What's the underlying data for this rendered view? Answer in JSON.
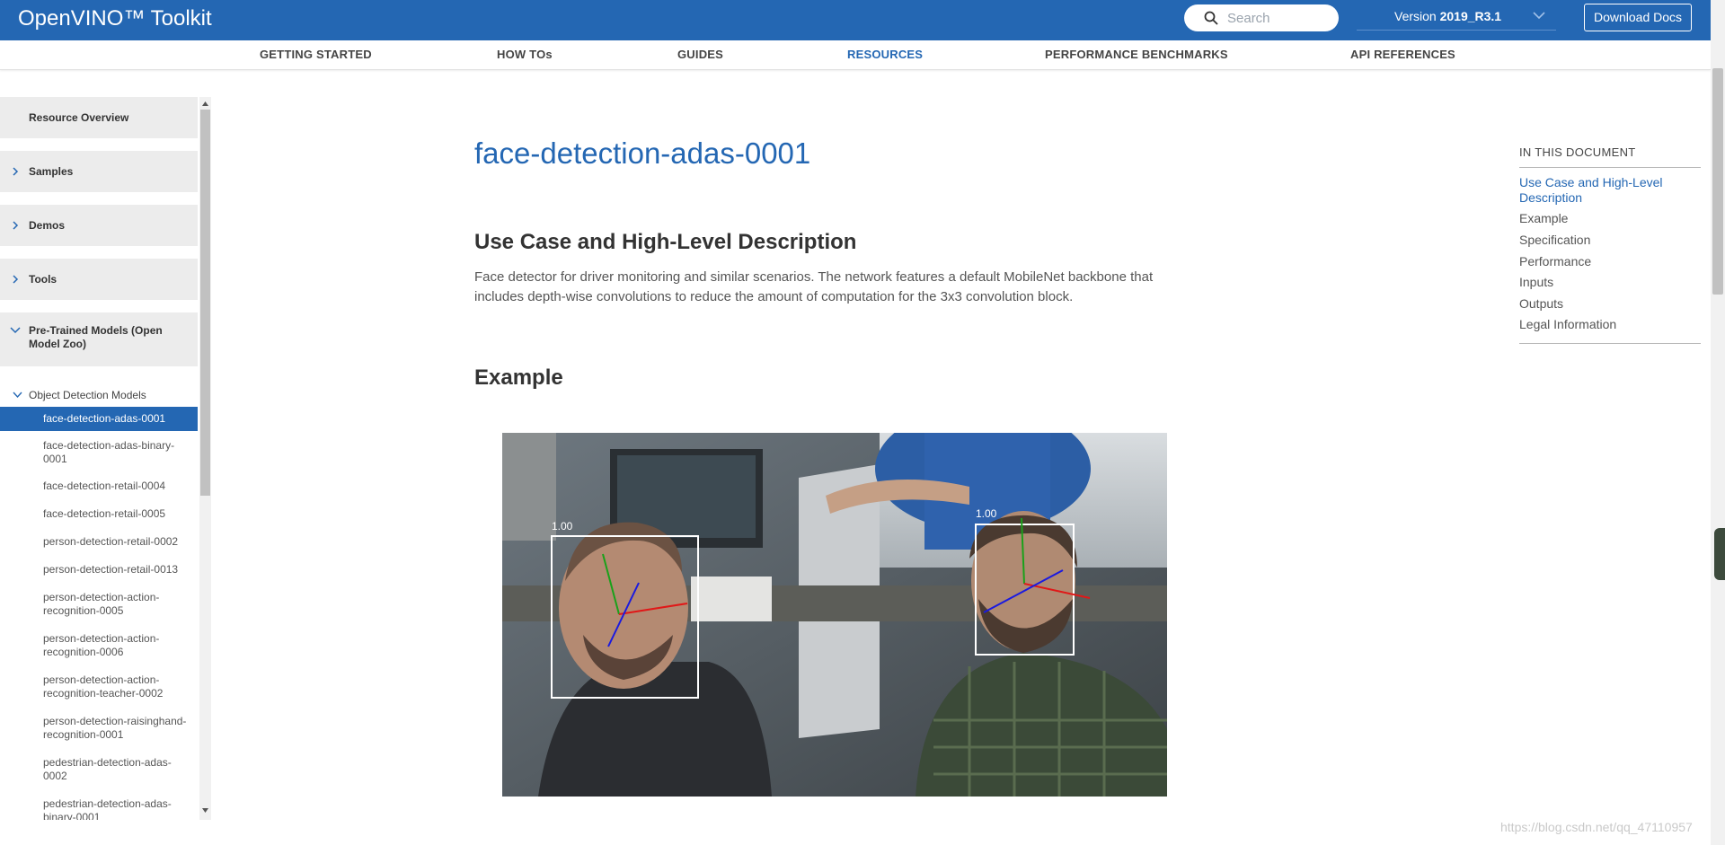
{
  "header": {
    "brand": "OpenVINO™ Toolkit",
    "search_placeholder": "Search",
    "version_prefix": "Version ",
    "version_value": "2019_R3.1",
    "download_label": "Download Docs"
  },
  "nav": {
    "items": [
      "GETTING STARTED",
      "HOW TOs",
      "GUIDES",
      "RESOURCES",
      "PERFORMANCE BENCHMARKS",
      "API REFERENCES"
    ],
    "active": "RESOURCES"
  },
  "sidebar": {
    "overview": "Resource Overview",
    "samples": "Samples",
    "demos": "Demos",
    "tools": "Tools",
    "pretrained": "Pre-Trained Models (Open Model Zoo)",
    "group": "Object Detection Models",
    "active_item": "face-detection-adas-0001",
    "items": [
      "face-detection-adas-binary-0001",
      "face-detection-retail-0004",
      "face-detection-retail-0005",
      "person-detection-retail-0002",
      "person-detection-retail-0013",
      "person-detection-action-recognition-0005",
      "person-detection-action-recognition-0006",
      "person-detection-action-recognition-teacher-0002",
      "person-detection-raisinghand-recognition-0001",
      "pedestrian-detection-adas-0002",
      "pedestrian-detection-adas-binary-0001"
    ]
  },
  "main": {
    "title": "face-detection-adas-0001",
    "section1_title": "Use Case and High-Level Description",
    "section1_text": "Face detector for driver monitoring and similar scenarios. The network features a default MobileNet backbone that includes depth-wise convolutions to reduce the amount of computation for the 3x3 convolution block.",
    "section2_title": "Example",
    "example": {
      "box1_score": "1.00",
      "box2_score": "1.00"
    }
  },
  "toc": {
    "heading": "IN THIS DOCUMENT",
    "active": "Use Case and High-Level Description",
    "items": [
      "Example",
      "Specification",
      "Performance",
      "Inputs",
      "Outputs",
      "Legal Information"
    ]
  },
  "watermark": "https://blog.csdn.net/qq_47110957",
  "colors": {
    "brand_blue": "#2467b3",
    "sidebar_bg": "#ececec"
  }
}
